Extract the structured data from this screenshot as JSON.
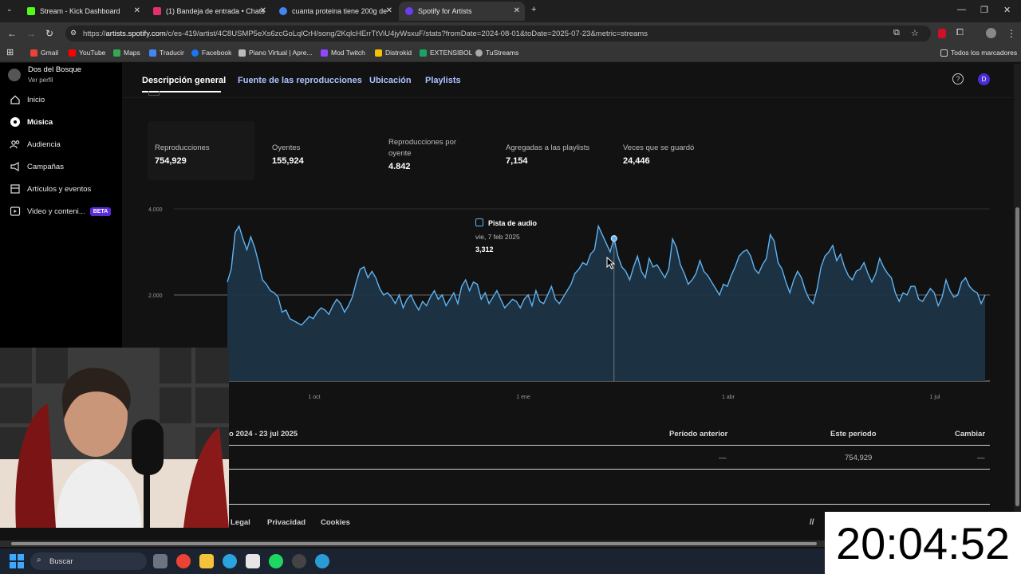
{
  "browser": {
    "tabs": [
      {
        "title": "Stream - Kick Dashboard",
        "color": "#53fc18"
      },
      {
        "title": "(1) Bandeja de entrada • Chats",
        "color": "#e1306c"
      },
      {
        "title": "cuanta proteina tiene 200g de",
        "color": "#4285f4"
      },
      {
        "title": "Spotify for Artists",
        "color": "#6b3cf5"
      }
    ],
    "url_prefix": "https://",
    "url_host": "artists.spotify.com",
    "url_path": "/c/es-419/artist/4C8USMP5eXs6zcGoLqlCrH/song/2KqlcHErrTtViU4jyWsxuF/stats?fromDate=2024-08-01&toDate=2025-07-23&metric=streams",
    "bookmarks": [
      "Gmail",
      "YouTube",
      "Maps",
      "Traducir",
      "Facebook",
      "Piano Virtual | Apre...",
      "Mod Twitch",
      "Distrokid",
      "EXTENSIBOL",
      "TuStreams"
    ],
    "all_bookmarks": "Todos los marcadores"
  },
  "sidebar": {
    "artist": "Dos del Bosque",
    "profile_link": "Ver perfil",
    "items": [
      {
        "label": "Inicio",
        "icon": "home-icon"
      },
      {
        "label": "Música",
        "icon": "music-icon"
      },
      {
        "label": "Audiencia",
        "icon": "audience-icon"
      },
      {
        "label": "Campañas",
        "icon": "campaign-icon"
      },
      {
        "label": "Artículos y eventos",
        "icon": "merch-icon"
      },
      {
        "label": "Video y conteni...",
        "icon": "video-icon"
      }
    ],
    "beta": "BETA"
  },
  "tabs": [
    "Descripción general",
    "Fuente de las reproducciones",
    "Ubicación",
    "Playlists"
  ],
  "avatar": "D",
  "stats": [
    {
      "label": "Reproducciones",
      "value": "754,929"
    },
    {
      "label": "Oyentes",
      "value": "155,924"
    },
    {
      "label": "Reproducciones por oyente",
      "value": "4.842"
    },
    {
      "label": "Agregadas a las playlists",
      "value": "7,154"
    },
    {
      "label": "Veces que se guardó",
      "value": "24,446"
    }
  ],
  "tooltip": {
    "title": "Pista de audio",
    "date": "vie, 7 feb 2025",
    "value": "3,312"
  },
  "chart_data": {
    "type": "area",
    "x_tick_labels": [
      "1 oct",
      "1 ene",
      "1 abr",
      "1 jul"
    ],
    "y_tick_labels": [
      "4,000",
      "2,000"
    ],
    "ylim": [
      0,
      4000
    ],
    "grid": true,
    "series": [
      {
        "name": "Pista de audio",
        "values": [
          2300,
          2600,
          3450,
          3600,
          3300,
          3050,
          3350,
          3100,
          2750,
          2350,
          2250,
          2100,
          2050,
          1950,
          1600,
          1650,
          1450,
          1400,
          1350,
          1300,
          1400,
          1500,
          1450,
          1600,
          1700,
          1650,
          1550,
          1750,
          1900,
          1800,
          1600,
          1750,
          1950,
          2300,
          2600,
          2650,
          2400,
          2550,
          2400,
          2150,
          2000,
          2050,
          1950,
          1800,
          2000,
          1700,
          1900,
          2000,
          1800,
          1650,
          1850,
          1750,
          1950,
          2100,
          1900,
          2000,
          1750,
          1900,
          2050,
          1800,
          2200,
          2350,
          2100,
          2300,
          2250,
          1900,
          2050,
          1800,
          1950,
          2100,
          1900,
          1700,
          1800,
          1900,
          1850,
          1700,
          1900,
          2000,
          1750,
          2100,
          1850,
          1800,
          2000,
          2200,
          1900,
          1800,
          1950,
          2100,
          2250,
          2500,
          2600,
          2750,
          2700,
          2950,
          3050,
          3600,
          3400,
          3200,
          3000,
          3312,
          2900,
          2650,
          2550,
          2350,
          2650,
          2900,
          2550,
          2400,
          2850,
          2650,
          2700,
          2550,
          2400,
          2600,
          3300,
          3100,
          2700,
          2500,
          2250,
          2350,
          2500,
          2800,
          2550,
          2450,
          2300,
          2150,
          2000,
          2250,
          2200,
          2450,
          2650,
          2900,
          3000,
          3050,
          2900,
          2600,
          2500,
          2700,
          2850,
          3400,
          3250,
          2750,
          2600,
          2300,
          2050,
          2350,
          2550,
          2400,
          2100,
          1900,
          1800,
          2150,
          2650,
          2900,
          3000,
          3150,
          2800,
          2950,
          2650,
          2450,
          2350,
          2550,
          2600,
          2750,
          2500,
          2300,
          2500,
          2850,
          2650,
          2500,
          2400,
          2050,
          1850,
          2050,
          2000,
          2200,
          2200,
          1900,
          1850,
          2000,
          2150,
          2050,
          1750,
          1950,
          2350,
          2100,
          1950,
          2000,
          2300,
          2400,
          2200,
          2100,
          2050,
          1800,
          2000
        ]
      }
    ]
  },
  "table": {
    "period_label": "o 2024 - 23 jul 2025",
    "headers": [
      "Período anterior",
      "Este período",
      "Cambiar"
    ],
    "row": [
      "—",
      "754,929",
      "—"
    ]
  },
  "footer": [
    "Legal",
    "Privacidad",
    "Cookies"
  ],
  "clock": "20:04:52",
  "taskbar_search": "Buscar"
}
